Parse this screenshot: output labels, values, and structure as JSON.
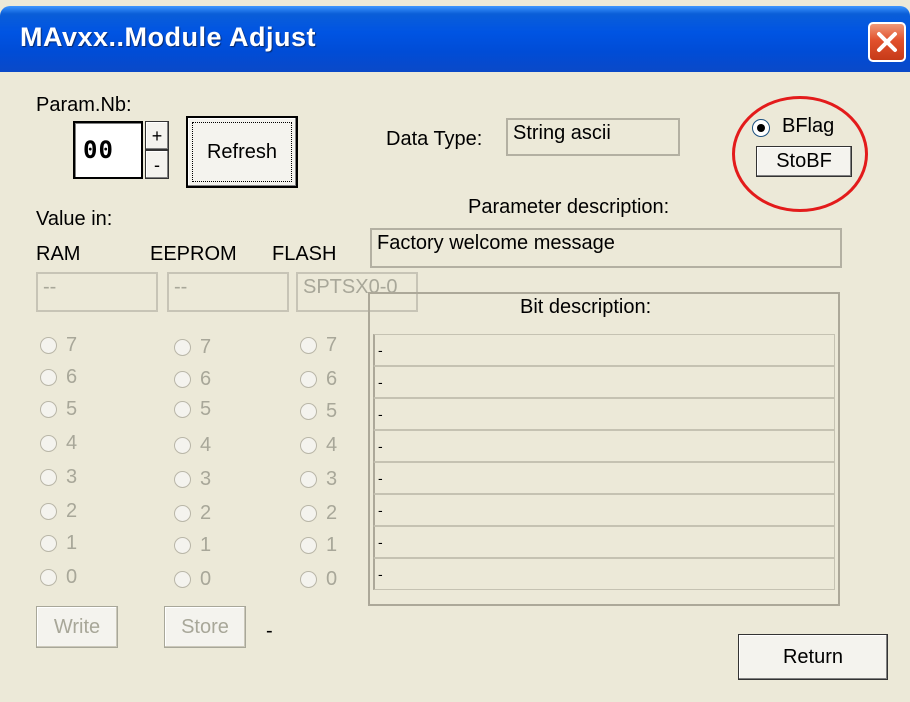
{
  "window": {
    "title": "MAvxx..Module Adjust",
    "colors": {
      "titlebar": "#0054e3",
      "face": "#ece9d8",
      "close": "#e2512d",
      "highlight_circle": "#e31b1b"
    }
  },
  "param": {
    "label": "Param.Nb:",
    "value": "00",
    "plus": "+",
    "minus": "-",
    "refresh": "Refresh"
  },
  "data_type": {
    "label": "Data Type:",
    "value": "String ascii"
  },
  "bflag": {
    "label": "BFlag",
    "button": "StoBF"
  },
  "param_desc": {
    "label": "Parameter description:",
    "value": "Factory welcome message"
  },
  "values": {
    "label": "Value in:",
    "columns": [
      {
        "name": "RAM",
        "value": "--"
      },
      {
        "name": "EEPROM",
        "value": "--"
      },
      {
        "name": "FLASH",
        "value": "SPTSX0-0"
      }
    ]
  },
  "bits": [
    "7",
    "6",
    "5",
    "4",
    "3",
    "2",
    "1",
    "0"
  ],
  "bit_desc": {
    "label": "Bit description:",
    "rows": [
      "-",
      "-",
      "-",
      "-",
      "-",
      "-",
      "-",
      "-"
    ]
  },
  "actions": {
    "write": "Write",
    "store": "Store",
    "status": "-",
    "return": "Return"
  },
  "icons": {
    "close": "close-icon"
  }
}
